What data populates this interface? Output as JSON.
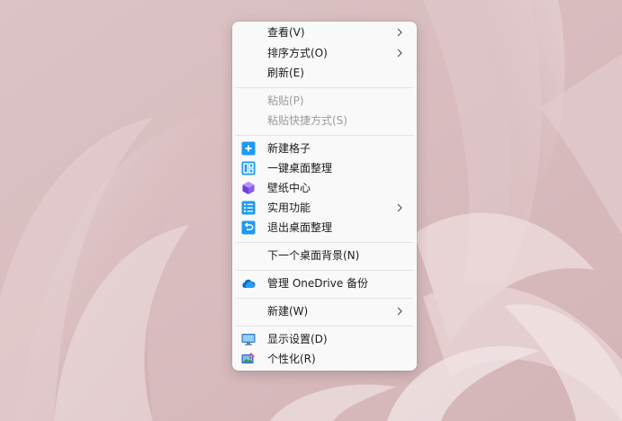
{
  "context_menu": {
    "items": [
      {
        "label": "查看(V)",
        "has_submenu": true,
        "enabled": true
      },
      {
        "label": "排序方式(O)",
        "has_submenu": true,
        "enabled": true
      },
      {
        "label": "刷新(E)",
        "has_submenu": false,
        "enabled": true
      },
      {
        "label": "粘贴(P)",
        "has_submenu": false,
        "enabled": false
      },
      {
        "label": "粘贴快捷方式(S)",
        "has_submenu": false,
        "enabled": false
      },
      {
        "label": "新建格子",
        "icon": "plus-tile-icon",
        "has_submenu": false,
        "enabled": true
      },
      {
        "label": "一键桌面整理",
        "icon": "layout-grid-icon",
        "has_submenu": false,
        "enabled": true
      },
      {
        "label": "壁纸中心",
        "icon": "wallpaper-cube-icon",
        "has_submenu": false,
        "enabled": true
      },
      {
        "label": "实用功能",
        "icon": "list-icon",
        "has_submenu": true,
        "enabled": true
      },
      {
        "label": "退出桌面整理",
        "icon": "undo-icon",
        "has_submenu": false,
        "enabled": true
      },
      {
        "label": "下一个桌面背景(N)",
        "has_submenu": false,
        "enabled": true
      },
      {
        "label": "管理 OneDrive 备份",
        "icon": "onedrive-cloud-icon",
        "has_submenu": false,
        "enabled": true
      },
      {
        "label": "新建(W)",
        "has_submenu": true,
        "enabled": true
      },
      {
        "label": "显示设置(D)",
        "icon": "monitor-icon",
        "has_submenu": false,
        "enabled": true
      },
      {
        "label": "个性化(R)",
        "icon": "personalize-icon",
        "has_submenu": false,
        "enabled": true
      }
    ]
  },
  "colors": {
    "menu_background": "#f9f9f9",
    "text": "#1b1b1b",
    "disabled_text": "#9c9c9c",
    "separator": "#e3e3e3",
    "accent_icon": "#1e9bf0",
    "wallpaper": "#d9bfc1"
  }
}
